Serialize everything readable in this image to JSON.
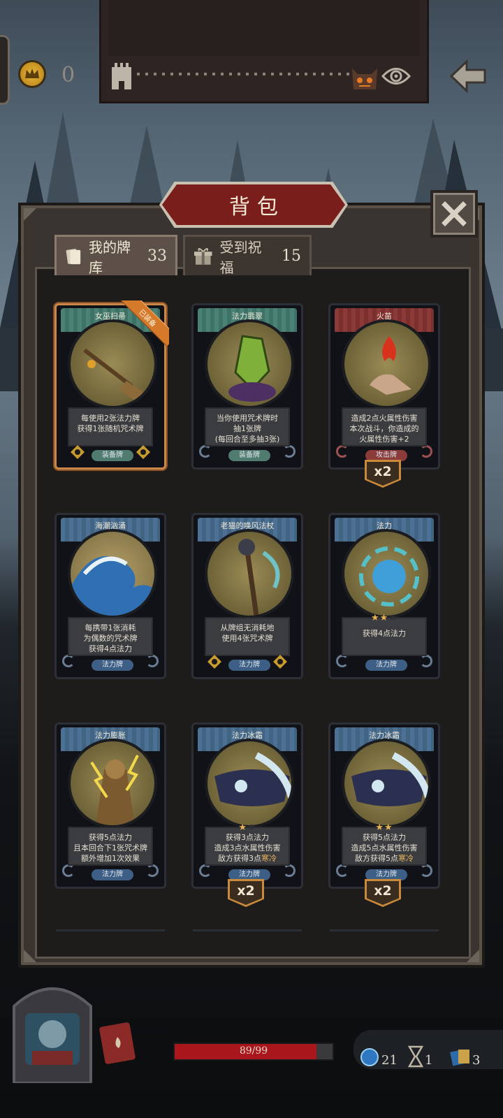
{
  "top": {
    "gold": "0"
  },
  "panel": {
    "title": "背包",
    "tabs": [
      {
        "label": "我的牌库",
        "count": "33"
      },
      {
        "label": "受到祝福",
        "count": "15"
      }
    ]
  },
  "cards": [
    {
      "name": "女巫扫帚",
      "desc": [
        "每使用2张法力牌",
        "获得1张随机咒术牌"
      ],
      "type": "装备牌",
      "badge": "已装备"
    },
    {
      "name": "法力翡翠",
      "desc": [
        "当你使用咒术牌时",
        "抽1张牌",
        "(每回合至多抽3张)"
      ],
      "type": "装备牌"
    },
    {
      "name": "火苗",
      "desc": [
        "造成2点火属性伤害",
        "本次战斗，你造成的",
        "火属性伤害+2"
      ],
      "type": "攻击牌",
      "mult": "x2"
    },
    {
      "name": "海潮汹涌",
      "desc": [
        "每携带1张消耗",
        "为偶数的咒术牌",
        "获得4点法力"
      ],
      "type": "法力牌"
    },
    {
      "name": "老猫的唤风法杖",
      "desc": [
        "从牌组无消耗地",
        "使用4张咒术牌"
      ],
      "type": "法力牌"
    },
    {
      "name": "法力",
      "desc": [
        "获得4点法力"
      ],
      "type": "法力牌",
      "stars": 2
    },
    {
      "name": "法力膨胀",
      "desc": [
        "获得5点法力",
        "且本回合下1张咒术牌",
        "额外增加1次效果"
      ],
      "type": "法力牌"
    },
    {
      "name": "法力冰霜",
      "desc": [
        "获得3点法力",
        "造成3点水属性伤害",
        "敌方获得3点寒冷"
      ],
      "type": "法力牌",
      "stars": 1,
      "mult": "x2"
    },
    {
      "name": "法力冰霜",
      "desc": [
        "获得5点法力",
        "造成5点水属性伤害",
        "敌方获得5点寒冷"
      ],
      "type": "法力牌",
      "stars": 2,
      "mult": "x2"
    }
  ],
  "bottom": {
    "hp": "89/99",
    "hp_fraction": 0.9,
    "stats": [
      {
        "icon": "mana-orb-icon",
        "value": "21"
      },
      {
        "icon": "hourglass-icon",
        "value": "1"
      },
      {
        "icon": "cards-icon",
        "value": "3"
      }
    ]
  },
  "colors": {
    "equipped_border": "#c9884a",
    "hp_red": "#a9171c",
    "title_red": "#7a1e1b"
  }
}
